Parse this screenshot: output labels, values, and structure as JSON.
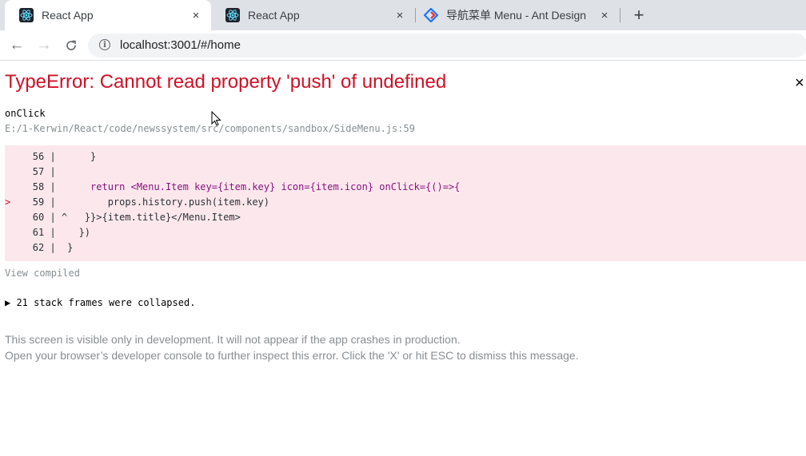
{
  "browser": {
    "tabs": [
      {
        "title": "React App",
        "close_icon": "×",
        "active": true,
        "favicon": "react-icon"
      },
      {
        "title": "React App",
        "close_icon": "×",
        "active": false,
        "favicon": "react-icon"
      },
      {
        "title": "导航菜单 Menu - Ant Design",
        "close_icon": "×",
        "active": false,
        "favicon": "ant-design-icon"
      }
    ],
    "new_tab_label": "+",
    "nav": {
      "back": "←",
      "forward": "→",
      "reload": "C"
    },
    "address_bar": {
      "url": "localhost:3001/#/home",
      "info_icon": "i"
    }
  },
  "error": {
    "title": "TypeError: Cannot read property 'push' of undefined",
    "dismiss": "×",
    "function": "onClick",
    "file": "E:/1-Kerwin/React/code/newssystem/src/components/sandbox/SideMenu.js:59",
    "code_lines": [
      {
        "marker": " ",
        "num": "56",
        "gutter": " |",
        "text": "      }"
      },
      {
        "marker": " ",
        "num": "57",
        "gutter": " |",
        "text": ""
      },
      {
        "marker": " ",
        "num": "58",
        "gutter": " |",
        "text": "      return <Menu.Item key={item.key} icon={item.icon} onClick={()=>{"
      },
      {
        "marker": ">",
        "num": "59",
        "gutter": " |",
        "text": "         props.history.push(item.key)"
      },
      {
        "marker": " ",
        "num": "60",
        "gutter": " | ^",
        "text": "   }}>{item.title}</Menu.Item>"
      },
      {
        "marker": " ",
        "num": "61",
        "gutter": " |",
        "text": "    })"
      },
      {
        "marker": " ",
        "num": "62",
        "gutter": " |",
        "text": "  }"
      }
    ],
    "view_compiled": "View compiled",
    "stack_frames": "▶ 21 stack frames were collapsed.",
    "note_line1": "This screen is visible only in development. It will not appear if the app crashes in production.",
    "note_line2": "Open your browser’s developer console to further inspect this error.  Click the 'X' or hit ESC to dismiss this message."
  },
  "colors": {
    "error_red": "#ce1126",
    "code_bg": "#fce8ec",
    "muted": "#878e91"
  }
}
